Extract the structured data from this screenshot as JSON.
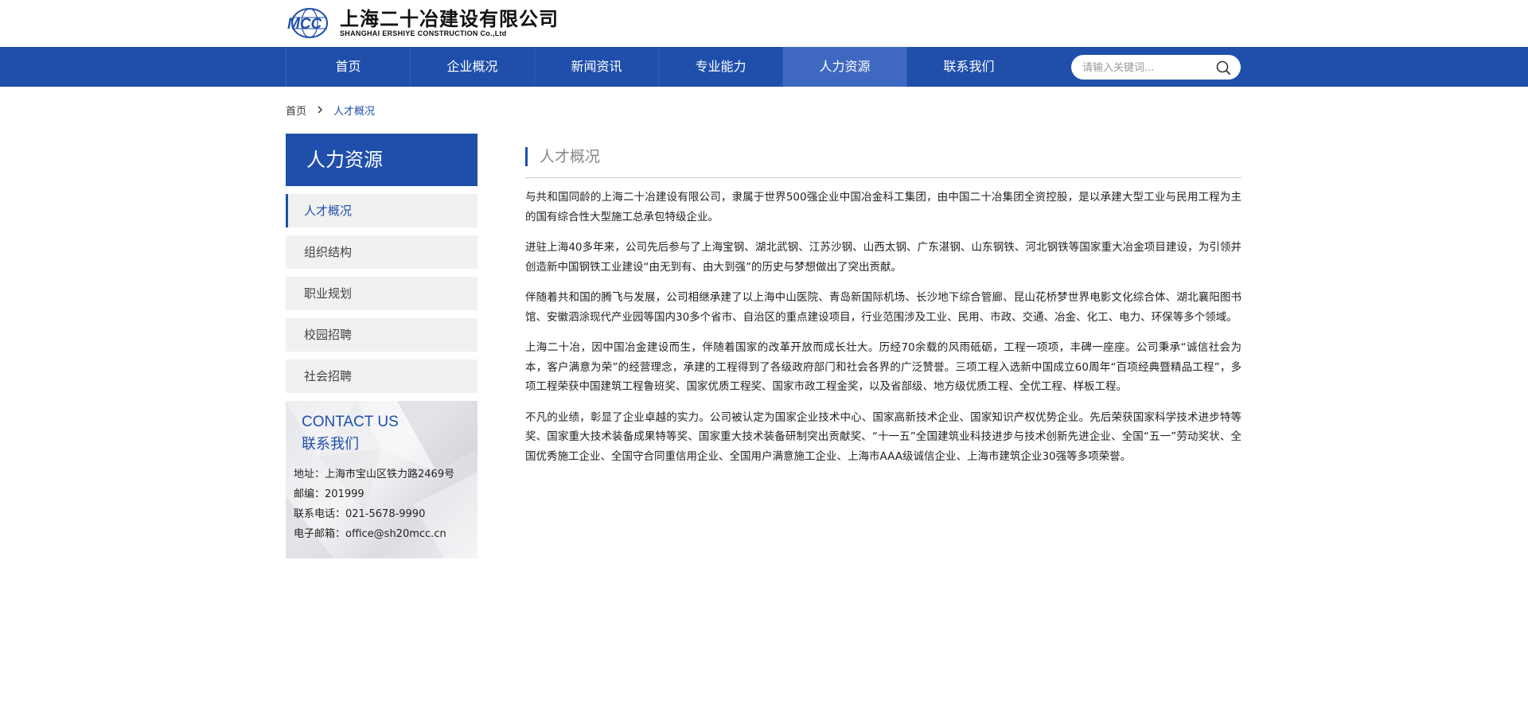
{
  "company": {
    "name_cn": "上海二十冶建设有限公司",
    "name_en": "SHANGHAI ERSHIYE CONSTRUCTION Co.,Ltd",
    "logo_mark_text": "MCC"
  },
  "nav": {
    "items": [
      {
        "label": "首页"
      },
      {
        "label": "企业概况"
      },
      {
        "label": "新闻资讯"
      },
      {
        "label": "专业能力"
      },
      {
        "label": "人力资源"
      },
      {
        "label": "联系我们"
      }
    ],
    "active_index": 4,
    "search_placeholder": "请输入关键词..."
  },
  "breadcrumb": {
    "home": "首页",
    "current": "人才概况"
  },
  "sidebar": {
    "title": "人力资源",
    "items": [
      {
        "label": "人才概况"
      },
      {
        "label": "组织结构"
      },
      {
        "label": "职业规划"
      },
      {
        "label": "校园招聘"
      },
      {
        "label": "社会招聘"
      }
    ],
    "active_index": 0,
    "contact": {
      "title_en": "CONTACT US",
      "title_cn": "联系我们",
      "address": "地址：上海市宝山区铁力路2469号",
      "postcode": "邮编：201999",
      "phone": "联系电话：021-5678-9990",
      "email": "电子邮箱：office@sh20mcc.cn"
    }
  },
  "content": {
    "title": "人才概况",
    "paragraphs": [
      "与共和国同龄的上海二十冶建设有限公司，隶属于世界500强企业中国冶金科工集团，由中国二十冶集团全资控股，是以承建大型工业与民用工程为主的国有综合性大型施工总承包特级企业。",
      "进驻上海40多年来，公司先后参与了上海宝钢、湖北武钢、江苏沙钢、山西太钢、广东湛钢、山东钢铁、河北钢铁等国家重大冶金项目建设，为引领并创造新中国钢铁工业建设“由无到有、由大到强”的历史与梦想做出了突出贡献。",
      "伴随着共和国的腾飞与发展，公司相继承建了以上海中山医院、青岛新国际机场、长沙地下综合管廊、昆山花桥梦世界电影文化综合体、湖北襄阳图书馆、安徽泗涂现代产业园等国内30多个省市、自治区的重点建设项目，行业范围涉及工业、民用、市政、交通、冶金、化工、电力、环保等多个领域。",
      "上海二十冶，因中国冶金建设而生，伴随着国家的改革开放而成长壮大。历经70余载的风雨砥砺，工程一项项，丰碑一座座。公司秉承“诚信社会为本，客户满意为荣”的经营理念，承建的工程得到了各级政府部门和社会各界的广泛赞誉。三项工程入选新中国成立60周年“百项经典暨精品工程”，多项工程荣获中国建筑工程鲁班奖、国家优质工程奖、国家市政工程金奖，以及省部级、地方级优质工程、全优工程、样板工程。",
      "不凡的业绩，彰显了企业卓越的实力。公司被认定为国家企业技术中心、国家高新技术企业、国家知识产权优势企业。先后荣获国家科学技术进步特等奖、国家重大技术装备成果特等奖、国家重大技术装备研制突出贡献奖、“十一五”全国建筑业科技进步与技术创新先进企业、全国“五一”劳动奖状、全国优秀施工企业、全国守合同重信用企业、全国用户满意施工企业、上海市AAA级诚信企业、上海市建筑企业30强等多项荣誉。"
    ]
  },
  "colors": {
    "brand_blue": "#1f4fab",
    "nav_active": "#3f69c0",
    "sidebar_item_bg": "#f1f1f1"
  },
  "icons": {
    "search": "search-icon",
    "breadcrumb_separator": "chevron-right-icon",
    "logo": "mcc-logo-icon"
  }
}
